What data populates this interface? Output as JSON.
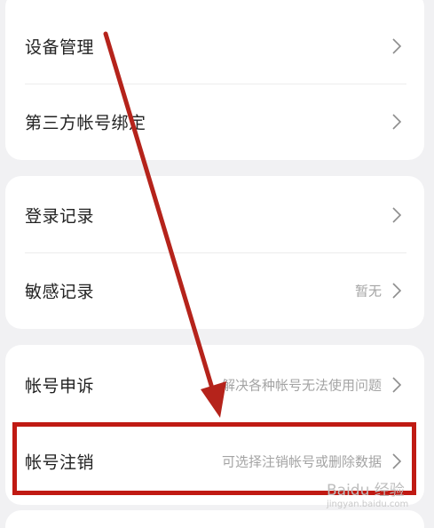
{
  "group1": {
    "items": [
      {
        "label": "设备管理",
        "value": ""
      },
      {
        "label": "第三方帐号绑定",
        "value": ""
      }
    ]
  },
  "group2": {
    "items": [
      {
        "label": "登录记录",
        "value": ""
      },
      {
        "label": "敏感记录",
        "value": "暂无"
      }
    ]
  },
  "group3": {
    "items": [
      {
        "label": "帐号申诉",
        "value": "解决各种帐号无法使用问题"
      },
      {
        "label": "帐号注销",
        "value": "可选择注销帐号或删除数据"
      }
    ]
  },
  "watermark": {
    "brand": "Baidu 经验",
    "url": "jingyan.baidu.com"
  },
  "colors": {
    "highlight": "#c01a13",
    "arrow": "#b5231b"
  },
  "icons": {
    "chevron": "chevron-right-icon"
  }
}
